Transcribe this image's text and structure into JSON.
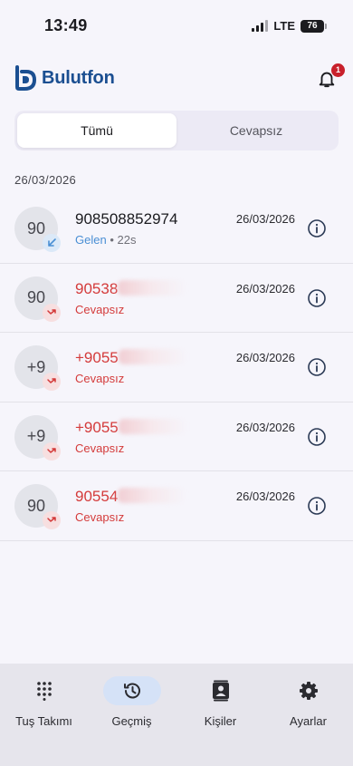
{
  "status": {
    "time": "13:49",
    "network": "LTE",
    "battery": "76"
  },
  "app": {
    "name": "Bulutfon",
    "notification_count": "1"
  },
  "tabs": [
    {
      "label": "Tümü",
      "active": true
    },
    {
      "label": "Cevapsız",
      "active": false
    }
  ],
  "date_group": "26/03/2026",
  "calls": [
    {
      "avatar": "90",
      "number": "908508852974",
      "redacted": false,
      "type": "incoming",
      "status": "Gelen",
      "duration": "22s",
      "date": "26/03/2026"
    },
    {
      "avatar": "90",
      "number": "90538",
      "redacted": true,
      "type": "missed",
      "status": "Cevapsız",
      "duration": "",
      "date": "26/03/2026"
    },
    {
      "avatar": "+9",
      "number": "+9055",
      "redacted": true,
      "type": "missed",
      "status": "Cevapsız",
      "duration": "",
      "date": "26/03/2026"
    },
    {
      "avatar": "+9",
      "number": "+9055",
      "redacted": true,
      "type": "missed",
      "status": "Cevapsız",
      "duration": "",
      "date": "26/03/2026"
    },
    {
      "avatar": "90",
      "number": "90554",
      "redacted": true,
      "type": "missed",
      "status": "Cevapsız",
      "duration": "",
      "date": "26/03/2026"
    }
  ],
  "nav": [
    {
      "label": "Tuş Takımı",
      "icon": "dialpad-icon",
      "active": false
    },
    {
      "label": "Geçmiş",
      "icon": "history-icon",
      "active": true
    },
    {
      "label": "Kişiler",
      "icon": "contacts-icon",
      "active": false
    },
    {
      "label": "Ayarlar",
      "icon": "gear-icon",
      "active": false
    }
  ],
  "colors": {
    "brand": "#1b4f91",
    "missed": "#d43b3b",
    "incoming": "#4a8fd4",
    "badge": "#c8202b",
    "nav_active": "#d5e2f7"
  }
}
